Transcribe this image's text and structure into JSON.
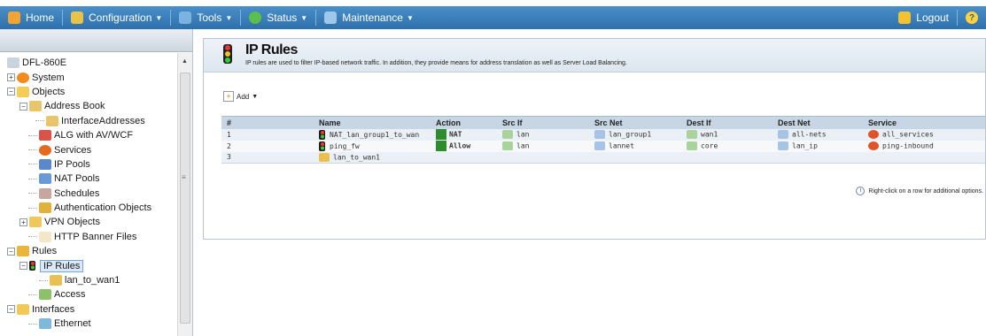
{
  "menu": {
    "home": "Home",
    "configuration": "Configuration",
    "tools": "Tools",
    "status": "Status",
    "maintenance": "Maintenance",
    "logout": "Logout",
    "help": "?"
  },
  "tree": {
    "root": "DFL-860E",
    "system": "System",
    "objects": "Objects",
    "address_book": "Address Book",
    "interface_addresses": "InterfaceAddresses",
    "alg": "ALG with AV/WCF",
    "services": "Services",
    "ip_pools": "IP Pools",
    "nat_pools": "NAT Pools",
    "schedules": "Schedules",
    "auth_objects": "Authentication Objects",
    "vpn_objects": "VPN Objects",
    "http_banner": "HTTP Banner Files",
    "rules": "Rules",
    "ip_rules": "IP Rules",
    "lan_to_wan1": "lan_to_wan1",
    "access": "Access",
    "interfaces": "Interfaces",
    "ethernet": "Ethernet"
  },
  "page": {
    "title": "IP Rules",
    "description": "IP rules are used to filter IP-based network traffic. In addition, they provide means for address translation as well as Server Load Balancing.",
    "add_label": "Add",
    "hint": "Right-click on a row for additional options."
  },
  "table": {
    "headers": [
      "#",
      "Name",
      "Action",
      "Src If",
      "Src Net",
      "Dest If",
      "Dest Net",
      "Service"
    ],
    "rows": [
      {
        "num": "1",
        "name": "NAT_lan_group1_to_wan",
        "action": "NAT",
        "src_if": "lan",
        "src_net": "lan_group1",
        "dest_if": "wan1",
        "dest_net": "all-nets",
        "service": "all_services"
      },
      {
        "num": "2",
        "name": "ping_fw",
        "action": "Allow",
        "src_if": "lan",
        "src_net": "lannet",
        "dest_if": "core",
        "dest_net": "lan_ip",
        "service": "ping-inbound"
      },
      {
        "num": "3",
        "name": "lan_to_wan1",
        "action": "",
        "src_if": "",
        "src_net": "",
        "dest_if": "",
        "dest_net": "",
        "service": ""
      }
    ]
  },
  "colors": {
    "menubar": "#3a7fbd",
    "table_header": "#c6d6e5",
    "selection": "#dbe8f6"
  }
}
